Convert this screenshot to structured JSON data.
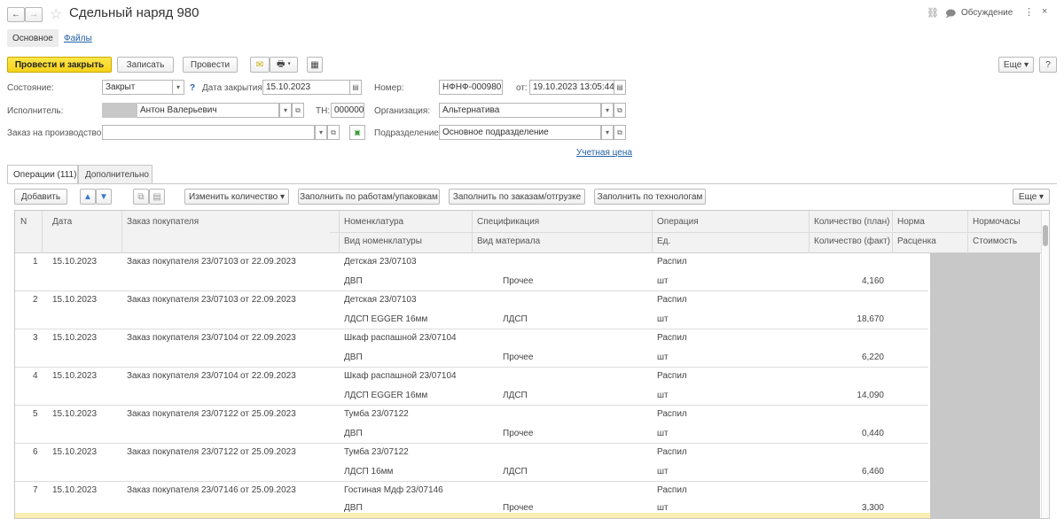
{
  "title_bar": {
    "title": "Сдельный наряд 980",
    "discussion": "Обсуждение"
  },
  "nav_tabs": [
    "Основное",
    "Файлы"
  ],
  "toolbar": {
    "post_close": "Провести и закрыть",
    "save": "Записать",
    "post": "Провести",
    "more": "Еще",
    "help": "?"
  },
  "header": {
    "state_label": "Состояние:",
    "state_value": "Закрыт",
    "close_date_label": "Дата закрытия:",
    "close_date_value": "15.10.2023",
    "number_label": "Номер:",
    "number_value": "НФНФ-000980",
    "from_label": "от:",
    "from_value": "19.10.2023 13:05:44",
    "executor_label": "Исполнитель:",
    "executor_value": "Антон Валерьевич",
    "tn_label": "ТН:",
    "tn_value": "000000",
    "org_label": "Организация:",
    "org_value": "Альтернатива",
    "order_label": "Заказ на производство:",
    "order_value": "",
    "division_label": "Подразделение:",
    "division_value": "Основное подразделение",
    "account_price_link": "Учетная цена"
  },
  "tabs": [
    "Операции (111)",
    "Дополнительно"
  ],
  "grid_toolbar": {
    "add": "Добавить",
    "change_qty": "Изменить количество",
    "fill_works": "Заполнить по работам/упаковкам",
    "fill_orders": "Заполнить по заказам/отгрузке",
    "fill_techs": "Заполнить по технологам",
    "more": "Еще"
  },
  "columns": {
    "n": "N",
    "date": "Дата",
    "order": "Заказ покупателя",
    "nomenclature": "Номенклатура",
    "nomenclature_kind": "Вид номенклатуры",
    "spec": "Спецификация",
    "material_kind": "Вид материала",
    "operation": "Операция",
    "unit": "Ед.",
    "qty_plan": "Количество (план)",
    "qty_fact": "Количество (факт)",
    "norm": "Норма",
    "rate": "Расценка",
    "norm_hours": "Нормочасы",
    "cost": "Стоимость"
  },
  "rows": [
    {
      "n": "1",
      "date": "15.10.2023",
      "order": "Заказ покупателя 23/07103",
      "order_date": "от 22.09.2023",
      "nom": "Детская 23/07103",
      "kind": "ДВП",
      "material": "Прочее",
      "op": "Распил",
      "unit": "шт",
      "qty_fact": "4,160"
    },
    {
      "n": "2",
      "date": "15.10.2023",
      "order": "Заказ покупателя 23/07103",
      "order_date": "от 22.09.2023",
      "nom": "Детская 23/07103",
      "kind": "ЛДСП EGGER 16мм",
      "material": "ЛДСП",
      "op": "Распил",
      "unit": "шт",
      "qty_fact": "18,670"
    },
    {
      "n": "3",
      "date": "15.10.2023",
      "order": "Заказ покупателя 23/07104",
      "order_date": "от 22.09.2023",
      "nom": "Шкаф распашной 23/07104",
      "kind": "ДВП",
      "material": "Прочее",
      "op": "Распил",
      "unit": "шт",
      "qty_fact": "6,220"
    },
    {
      "n": "4",
      "date": "15.10.2023",
      "order": "Заказ покупателя 23/07104",
      "order_date": "от 22.09.2023",
      "nom": "Шкаф распашной 23/07104",
      "kind": "ЛДСП EGGER 16мм",
      "material": "ЛДСП",
      "op": "Распил",
      "unit": "шт",
      "qty_fact": "14,090"
    },
    {
      "n": "5",
      "date": "15.10.2023",
      "order": "Заказ покупателя 23/07122",
      "order_date": "от 25.09.2023",
      "nom": "Тумба 23/07122",
      "kind": "ДВП",
      "material": "Прочее",
      "op": "Распил",
      "unit": "шт",
      "qty_fact": "0,440"
    },
    {
      "n": "6",
      "date": "15.10.2023",
      "order": "Заказ покупателя 23/07122",
      "order_date": "от 25.09.2023",
      "nom": "Тумба 23/07122",
      "kind": "ЛДСП 16мм",
      "material": "ЛДСП",
      "op": "Распил",
      "unit": "шт",
      "qty_fact": "6,460"
    },
    {
      "n": "7",
      "date": "15.10.2023",
      "order": "Заказ покупателя 23/07146",
      "order_date": "от 25.09.2023",
      "nom": "Гостиная Мдф 23/07146",
      "kind": "ДВП",
      "material": "Прочее",
      "op": "Распил",
      "unit": "шт",
      "qty_fact": "3,300"
    }
  ],
  "colors": {
    "accent_yellow": "#f5d21a",
    "link_blue": "#2060a8",
    "selected_row": "#fbeeb4",
    "redacted": "#c8c8c8"
  }
}
